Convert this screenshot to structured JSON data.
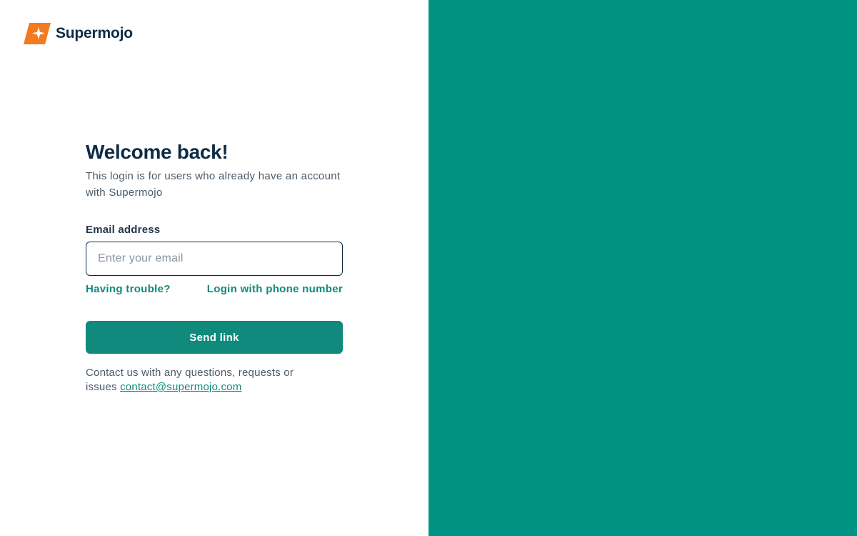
{
  "brand": {
    "name": "Supermojo",
    "logo_icon": "supermojo-logo-icon",
    "logo_color": "#F47A20"
  },
  "login": {
    "title": "Welcome back!",
    "subtitle": "This login is for users who already have an account with Supermojo",
    "email_label": "Email address",
    "email_placeholder": "Enter your email",
    "email_value": "",
    "trouble_link": "Having trouble?",
    "phone_link": "Login with phone number",
    "submit_label": "Send link",
    "contact_text": "Contact us with any questions, requests or issues",
    "contact_email": "contact@supermojo.com"
  },
  "colors": {
    "accent": "#0F8A7C",
    "side_panel": "#009383",
    "heading": "#0D2B45",
    "body_text": "#4A5A6A"
  }
}
